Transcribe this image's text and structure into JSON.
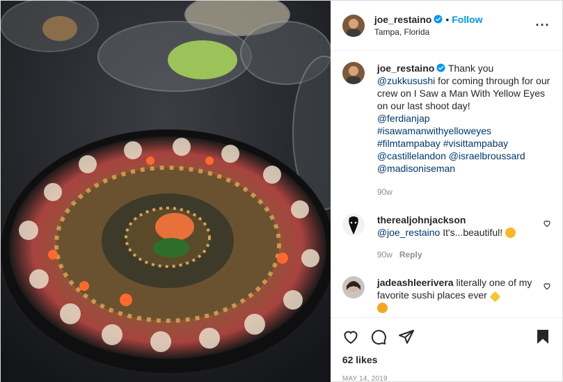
{
  "header": {
    "username": "joe_restaino",
    "follow_label": "Follow",
    "separator": "•",
    "location": "Tampa, Florida",
    "more_label": "···"
  },
  "caption": {
    "username": "joe_restaino",
    "text1": " Thank you ",
    "tag1": "@zukkusushi",
    "text2": " for coming through for our crew on I Saw a Man With Yellow Eyes on our last shoot day! ",
    "tag2": "@ferdianjap",
    "tag3": "#isawamanwithyelloweyes",
    "tag4": "#filmtampabay",
    "tag5": "#visittampabay",
    "tag6": "@castillelandon",
    "tag7": "@israelbroussard",
    "tag8": "@madisoniseman",
    "time": "90w"
  },
  "comments": [
    {
      "username": "therealjohnjackson",
      "tag": "@joe_restaino",
      "text": " It's...beautiful!",
      "time": "90w",
      "reply_label": "Reply"
    },
    {
      "username": "jadeashleerivera",
      "text": " literally one of my favorite sushi places ever"
    }
  ],
  "footer": {
    "likes": "62 likes",
    "date": "MAY 14, 2019"
  },
  "colors": {
    "accent": "#0095f6",
    "tag": "#00376b",
    "muted": "#8e8e8e"
  },
  "icons": {
    "verified": "verified-badge-icon",
    "like": "heart-icon",
    "comment": "comment-icon",
    "share": "paper-plane-icon",
    "save": "bookmark-icon"
  }
}
